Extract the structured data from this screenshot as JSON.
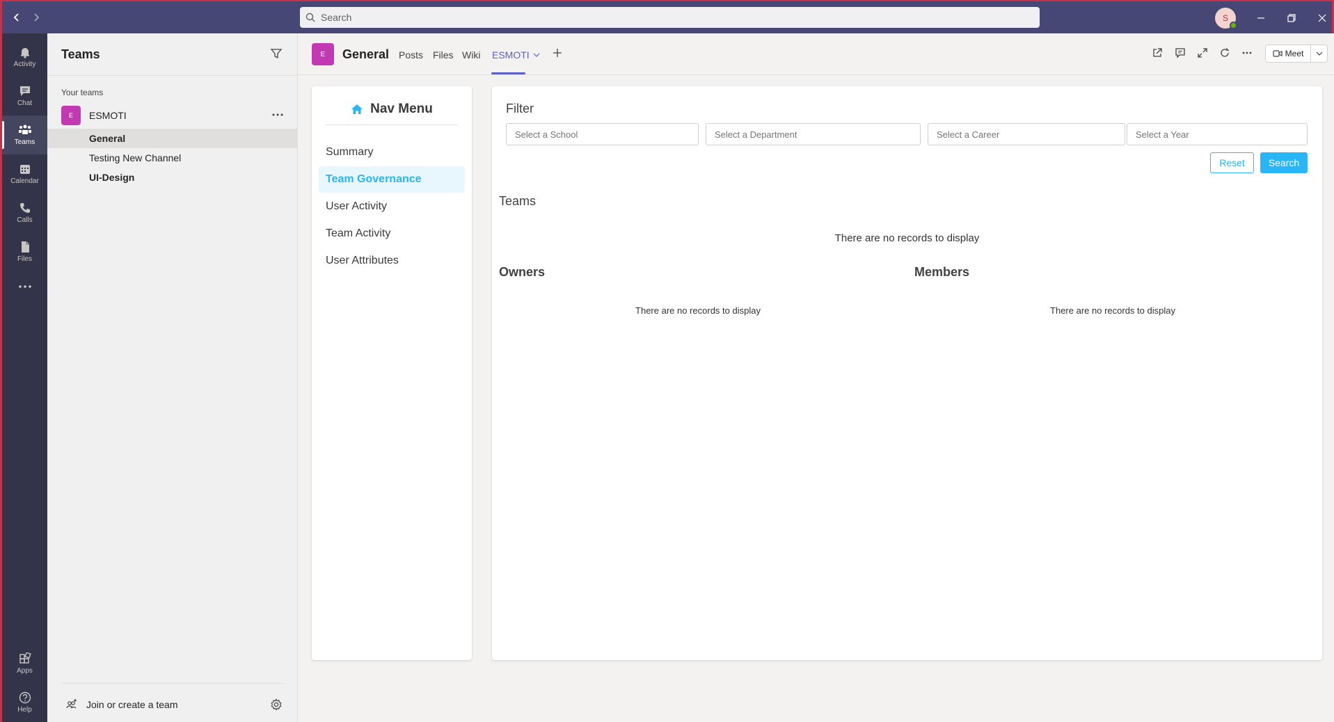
{
  "titlebar": {
    "search_placeholder": "Search",
    "avatar_initial": "S"
  },
  "rail": {
    "items": [
      {
        "label": "Activity",
        "icon": "bell-icon"
      },
      {
        "label": "Chat",
        "icon": "chat-icon"
      },
      {
        "label": "Teams",
        "icon": "teams-icon",
        "active": true
      },
      {
        "label": "Calendar",
        "icon": "calendar-icon"
      },
      {
        "label": "Calls",
        "icon": "phone-icon"
      },
      {
        "label": "Files",
        "icon": "file-icon"
      }
    ],
    "bottom": [
      {
        "label": "Apps",
        "icon": "apps-icon"
      },
      {
        "label": "Help",
        "icon": "help-icon"
      }
    ]
  },
  "teams_panel": {
    "title": "Teams",
    "section_label": "Your teams",
    "team": {
      "initial": "E",
      "name": "ESMOTI"
    },
    "channels": [
      "General",
      "Testing New Channel",
      "UI-Design"
    ],
    "join_label": "Join or create a team"
  },
  "channel_header": {
    "avatar_initial": "E",
    "name": "General",
    "tabs": [
      "Posts",
      "Files",
      "Wiki",
      "ESMOTI"
    ],
    "meet_label": "Meet"
  },
  "nav_menu": {
    "title": "Nav Menu",
    "items": [
      "Summary",
      "Team Governance",
      "User Activity",
      "Team Activity",
      "User Attributes"
    ]
  },
  "main": {
    "filter_label": "Filter",
    "placeholders": {
      "school": "Select a School",
      "department": "Select a Department",
      "career": "Select a Career",
      "year": "Select a Year"
    },
    "reset_label": "Reset",
    "search_label": "Search",
    "teams_title": "Teams",
    "empty_text": "There are no records to display",
    "owners_title": "Owners",
    "members_title": "Members"
  },
  "colors": {
    "titlebar": "#464775",
    "rail": "#33344a",
    "accent_teams": "#5b5fc7",
    "accent_app": "#29b6f6",
    "team_avatar": "#c239b3"
  }
}
